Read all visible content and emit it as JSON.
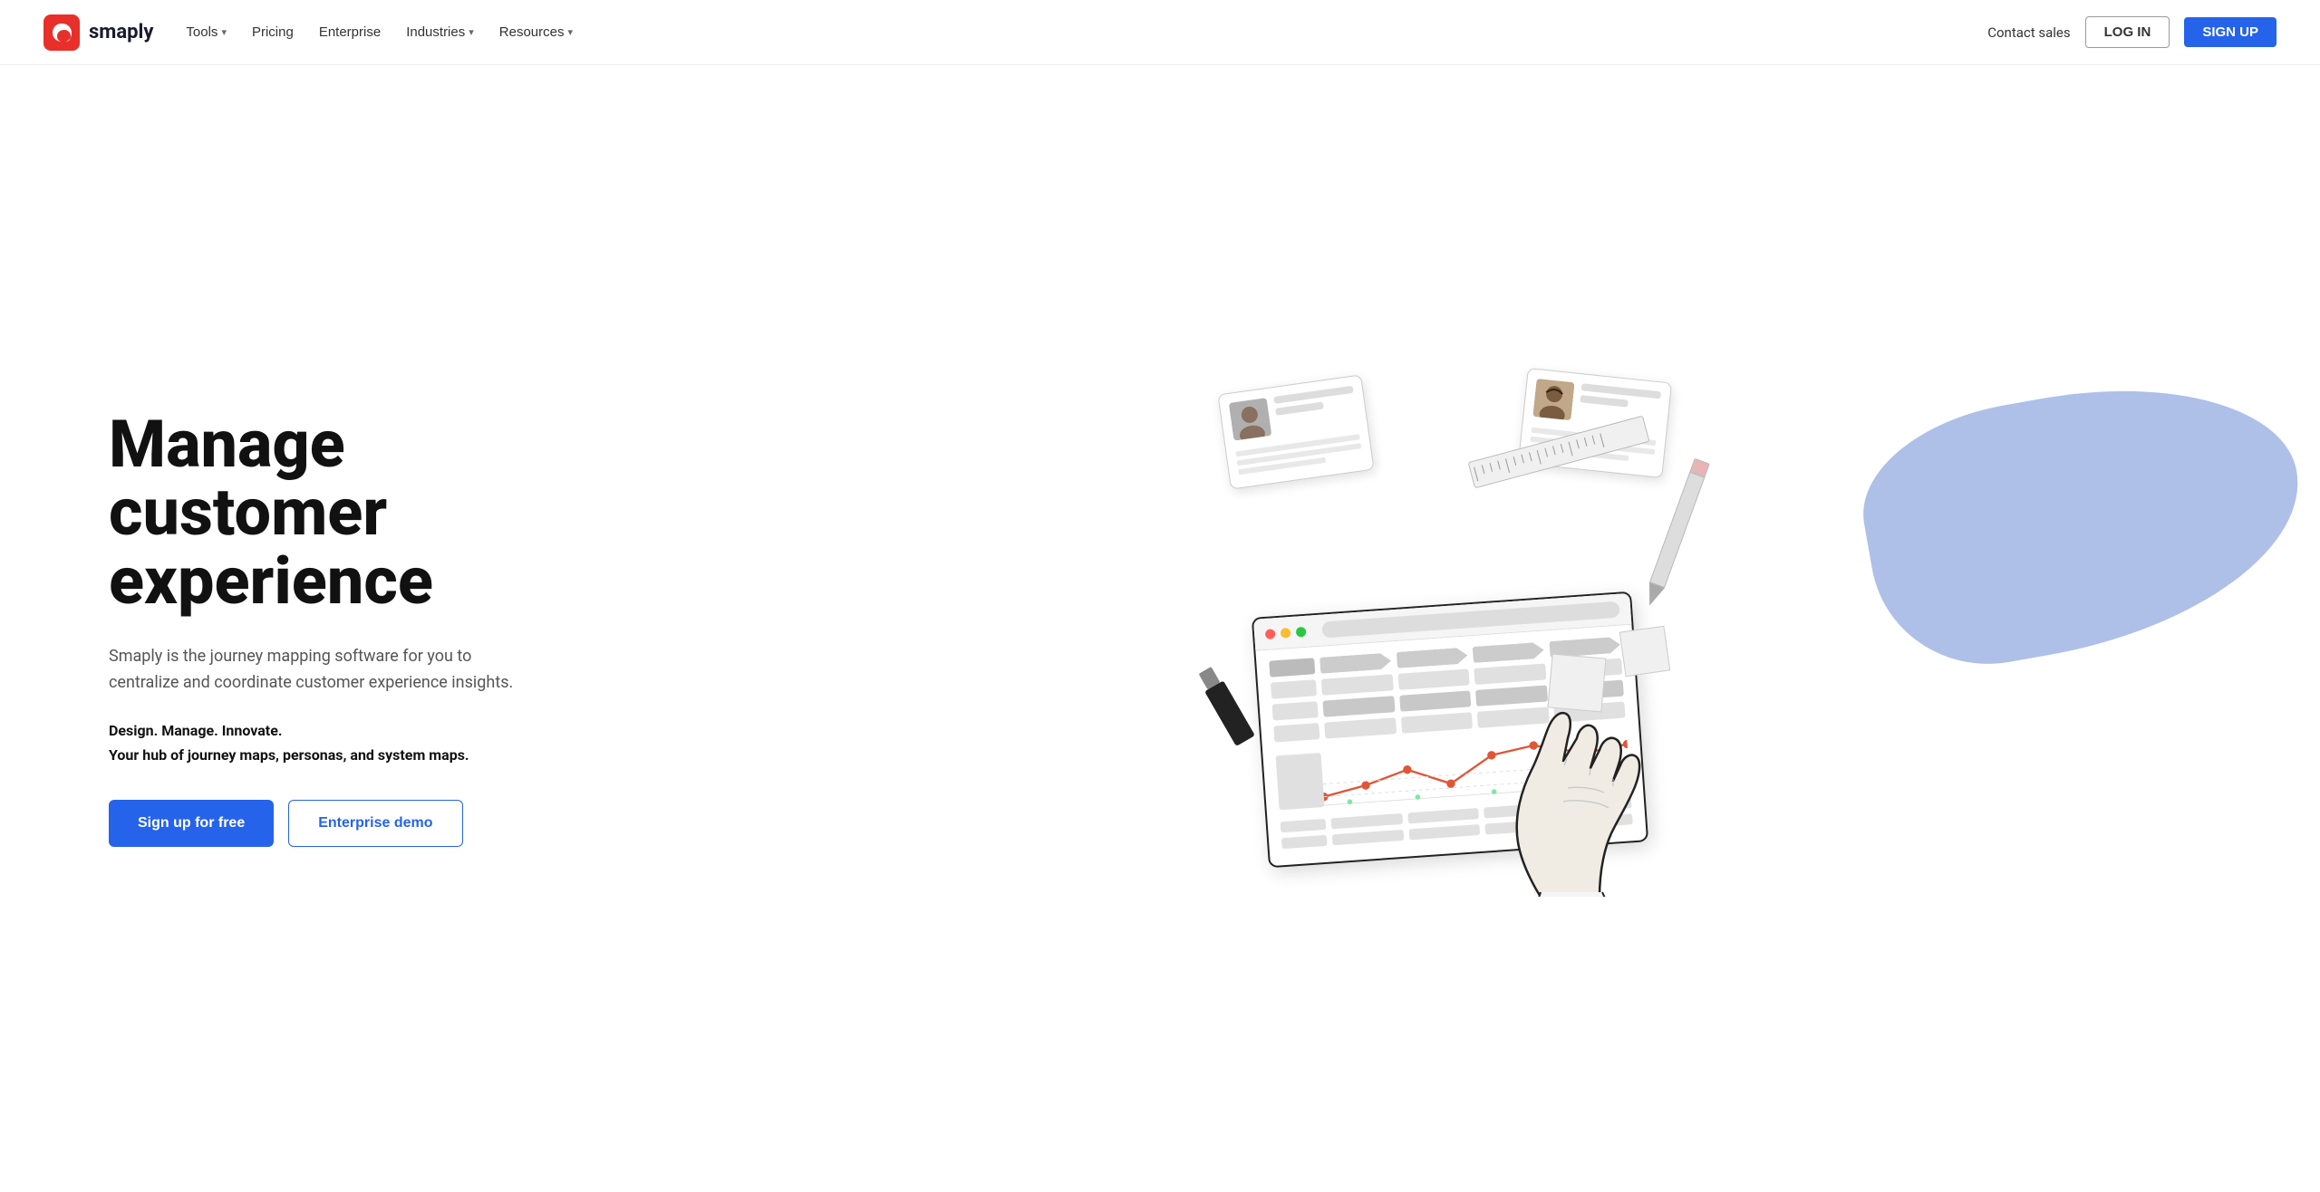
{
  "brand": {
    "name": "smaply",
    "logo_alt": "Smaply logo"
  },
  "nav": {
    "links": [
      {
        "label": "Tools",
        "has_dropdown": true
      },
      {
        "label": "Pricing",
        "has_dropdown": false
      },
      {
        "label": "Enterprise",
        "has_dropdown": false
      },
      {
        "label": "Industries",
        "has_dropdown": true
      },
      {
        "label": "Resources",
        "has_dropdown": true
      }
    ],
    "contact_sales": "Contact sales",
    "login": "LOG IN",
    "signup": "SIGN UP"
  },
  "hero": {
    "title": "Manage customer experience",
    "subtitle": "Smaply is the journey mapping software for you to centralize and coordinate customer experience insights.",
    "tagline_line1": "Design. Manage. Innovate.",
    "tagline_line2": "Your hub of journey maps, personas, and system maps.",
    "cta_primary": "Sign up for free",
    "cta_secondary": "Enterprise demo"
  }
}
